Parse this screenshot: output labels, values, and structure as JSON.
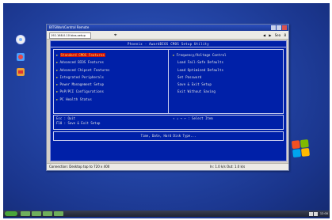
{
  "remote_window": {
    "title": "BITSWorkCentral Remote",
    "address": "192.168.0.10 bios-setup",
    "nav_back": "◀",
    "nav_forward": "▶",
    "nav_item1": "Sea",
    "nav_item2": "8",
    "status_left": "Connection: Desktop top to 720 x 400",
    "status_right": "In: 1.0 k/s   Out: 1.0 k/s"
  },
  "bios": {
    "header": "Phoenix - AwardBIOS CMOS Setup Utility",
    "left_items": [
      {
        "label": "Standard CMOS Features",
        "selected": true
      },
      {
        "label": "Advanced BIOS Features",
        "selected": false
      },
      {
        "label": "Advanced Chipset Features",
        "selected": false
      },
      {
        "label": "Integrated Peripherals",
        "selected": false
      },
      {
        "label": "Power Management Setup",
        "selected": false
      },
      {
        "label": "PnP/PCI Configurations",
        "selected": false
      },
      {
        "label": "PC Health Status",
        "selected": false
      }
    ],
    "right_items": [
      {
        "label": "Frequency/Voltage Control",
        "arrow": true
      },
      {
        "label": "Load Fail-Safe Defaults",
        "arrow": false
      },
      {
        "label": "Load Optimized Defaults",
        "arrow": false
      },
      {
        "label": "Set Password",
        "arrow": false
      },
      {
        "label": "Save & Exit Setup",
        "arrow": false
      },
      {
        "label": "Exit Without Saving",
        "arrow": false
      }
    ],
    "help": {
      "esc": "Esc : Quit",
      "f10": "F10 : Save & Exit Setup",
      "arrows": "↑ ↓ → ←  : Select Item"
    },
    "status_line": "Time, Date, Hard Disk Type..."
  },
  "taskbar": {
    "tray_time": "12:00"
  }
}
